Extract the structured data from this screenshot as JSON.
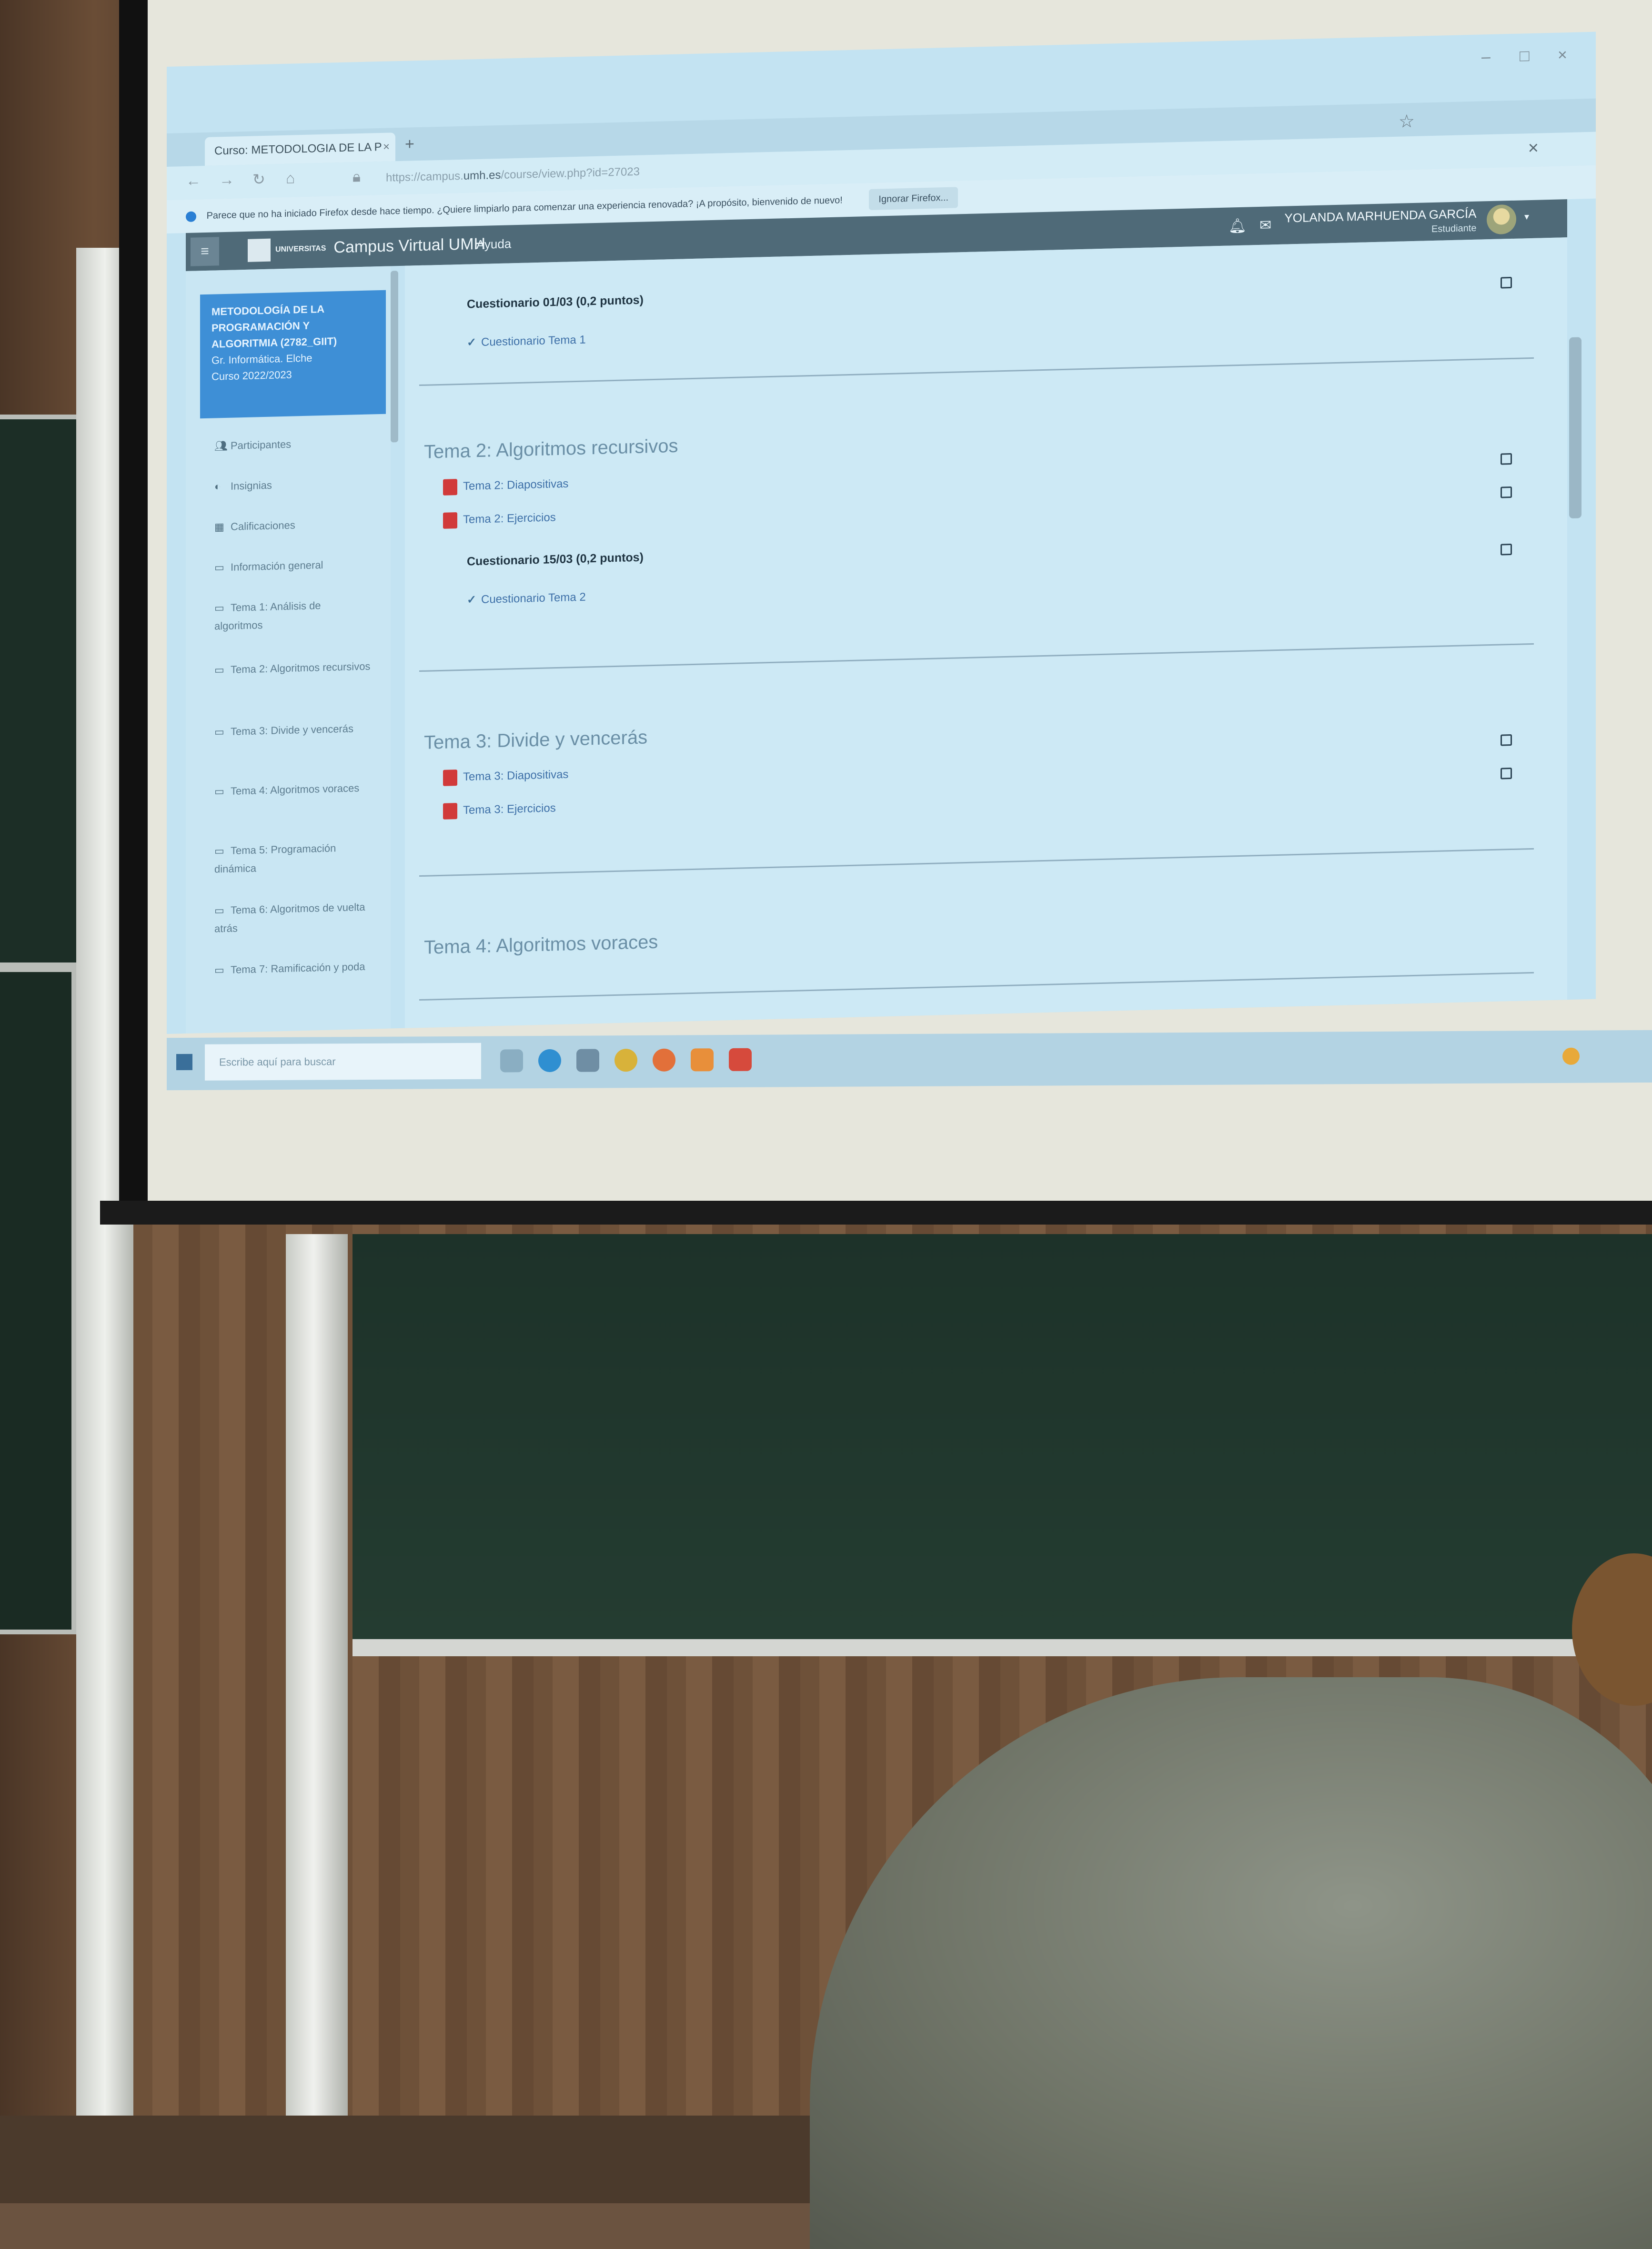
{
  "browser": {
    "tab_title": "Curso: METODOLOGIA DE LA P",
    "tab_close": "×",
    "new_tab": "+",
    "url_prefix": "https://campus.",
    "url_domain": "umh.es",
    "url_path": "/course/view.php?id=27023",
    "window_controls": {
      "minimize": "–",
      "maximize": "□",
      "close": "×"
    },
    "nav_close": "×"
  },
  "notice": {
    "text": "Parece que no ha iniciado Firefox desde hace tiempo. ¿Quiere limpiarlo para comenzar una experiencia renovada? ¡A propósito, bienvenido de nuevo!",
    "button": "Ignorar Firefox..."
  },
  "header": {
    "menu_icon": "≡",
    "logo_small": "UNIVERSITAS",
    "logo_text": "Campus Virtual UMH",
    "help": "Ayuda",
    "user_name": "YOLANDA MARHUENDA GARCÍA",
    "user_role": "Estudiante"
  },
  "sidebar": {
    "course_title": "METODOLOGÍA DE LA PROGRAMACIÓN Y ALGORITMIA (2782_GIIT)",
    "course_degree": "Gr. Informática. Elche",
    "course_year": "Curso 2022/2023",
    "items": [
      {
        "label": "Participantes",
        "icon": "users-icon"
      },
      {
        "label": "Insignias",
        "icon": "badge-icon"
      },
      {
        "label": "Calificaciones",
        "icon": "grades-icon"
      },
      {
        "label": "Información general",
        "icon": "folder-icon"
      },
      {
        "label": "Tema 1: Análisis de algoritmos",
        "icon": "folder-icon"
      },
      {
        "label": "Tema 2: Algoritmos recursivos",
        "icon": "folder-icon"
      },
      {
        "label": "Tema 3: Divide y vencerás",
        "icon": "folder-icon"
      },
      {
        "label": "Tema 4: Algoritmos voraces",
        "icon": "folder-icon"
      },
      {
        "label": "Tema 5: Programación dinámica",
        "icon": "folder-icon"
      },
      {
        "label": "Tema 6: Algoritmos de vuelta atrás",
        "icon": "folder-icon"
      },
      {
        "label": "Tema 7: Ramificación y poda",
        "icon": "folder-icon"
      }
    ]
  },
  "content": {
    "quiz1_title": "Cuestionario 01/03 (0,2 puntos)",
    "quiz1_link": "Cuestionario Tema 1",
    "section2_title": "Tema 2: Algoritmos recursivos",
    "section2_links": [
      "Tema 2: Diapositivas",
      "Tema 2: Ejercicios"
    ],
    "quiz2_title": "Cuestionario 15/03 (0,2 puntos)",
    "quiz2_link": "Cuestionario Tema 2",
    "section3_title": "Tema 3: Divide y vencerás",
    "section3_links": [
      "Tema 3: Diapositivas",
      "Tema 3: Ejercicios"
    ],
    "section4_title": "Tema 4: Algoritmos voraces"
  },
  "taskbar": {
    "search_placeholder": "Escribe aquí para buscar"
  },
  "colors": {
    "course_box": "#3e8fd6",
    "navbar": "#4f6a78",
    "pdf_icon": "#d13a3a",
    "link": "#3e70a8"
  }
}
